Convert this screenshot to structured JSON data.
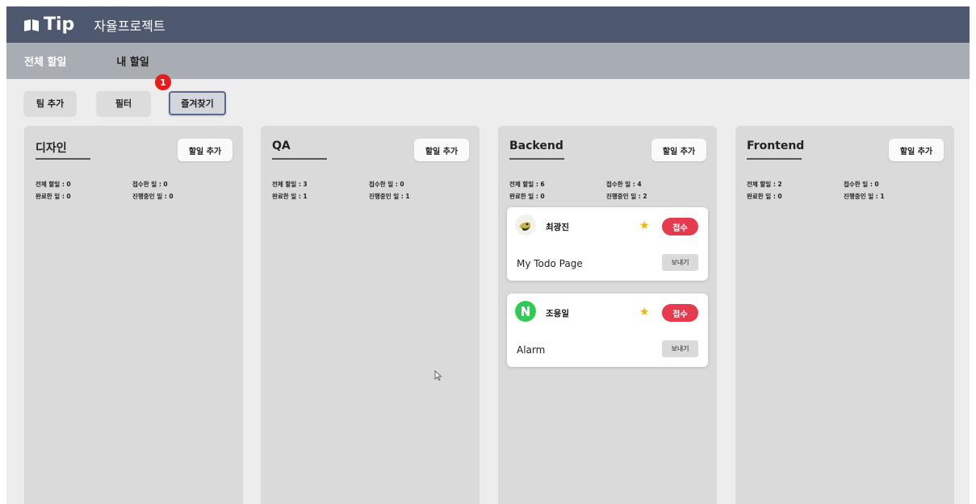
{
  "header": {
    "logo_text": "Tip",
    "app_title": "자율프로젝트"
  },
  "nav": {
    "tabs": [
      {
        "label": "전체 할일"
      },
      {
        "label": "내 할일"
      }
    ]
  },
  "toolbar": {
    "add_team_label": "팀 추가",
    "filter_label": "필터",
    "favorites_label": "즐겨찾기"
  },
  "marker": {
    "number": "1"
  },
  "columns": [
    {
      "title": "디자인",
      "add_label": "할일 추가",
      "stats": {
        "total": "전체 할일 : 0",
        "accepted": "접수한 일 : 0",
        "done": "완료한 일 : 0",
        "in_progress": "진행중인 일 : 0"
      }
    },
    {
      "title": "QA",
      "add_label": "할일 추가",
      "stats": {
        "total": "전체 할일 : 3",
        "accepted": "접수한 일 : 0",
        "done": "완료한 일 : 1",
        "in_progress": "진행중인 일 : 1"
      }
    },
    {
      "title": "Backend",
      "add_label": "할일 추가",
      "stats": {
        "total": "전체 할일 : 6",
        "accepted": "접수한 일 : 4",
        "done": "완료한 일 : 0",
        "in_progress": "진행중인 일 : 2"
      },
      "cards": [
        {
          "name": "최광진",
          "status": "접수",
          "title": "My Todo Page",
          "send_label": "보내기",
          "avatar": "bird-avatar-icon"
        },
        {
          "name": "조용일",
          "status": "접수",
          "title": "Alarm",
          "send_label": "보내기",
          "avatar": "n-logo-avatar-icon"
        }
      ]
    },
    {
      "title": "Frontend",
      "add_label": "할일 추가",
      "stats": {
        "total": "전체 할일 : 2",
        "accepted": "접수한 일 : 0",
        "done": "완료한 일 : 0",
        "in_progress": "진행중인 일 : 1"
      }
    }
  ],
  "colors": {
    "topbar": "#4e586e",
    "navbar": "#a7adb2",
    "status_badge": "#e63b4f",
    "star": "#f4b400",
    "marker": "#e81c1c"
  }
}
